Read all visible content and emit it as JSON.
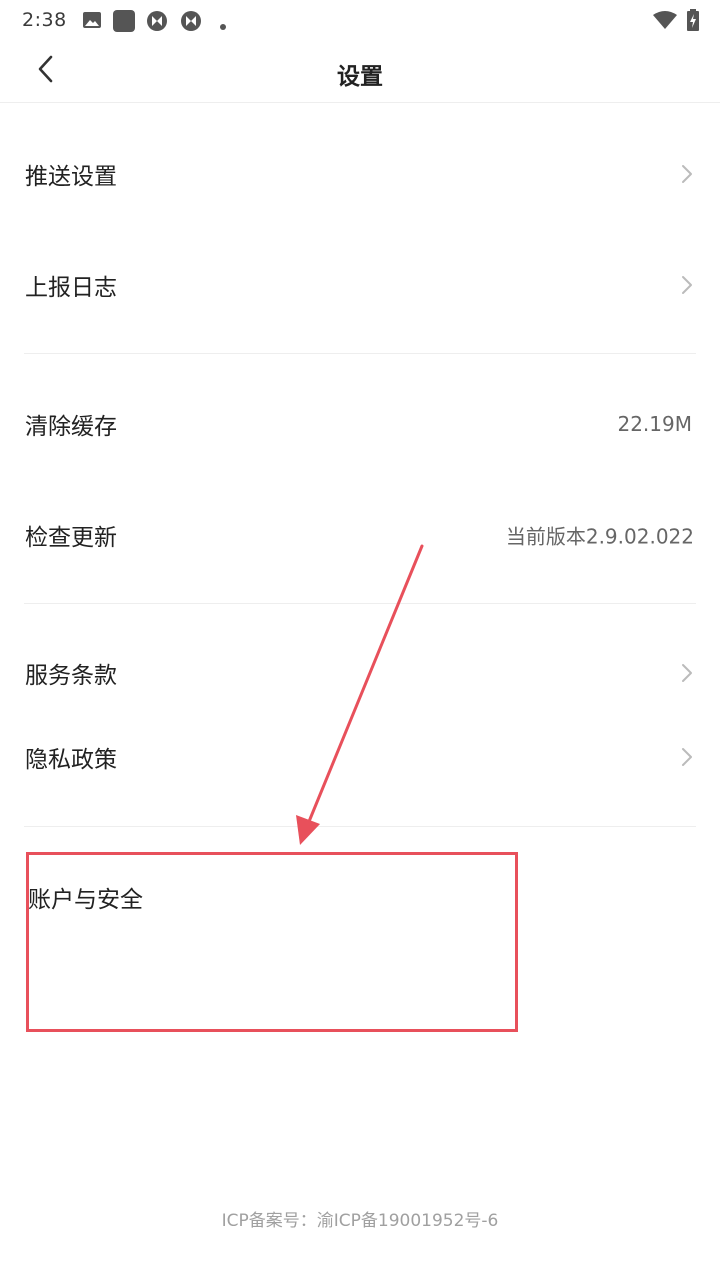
{
  "status_bar": {
    "time": "2:38",
    "icons": [
      "image-icon",
      "square-icon",
      "aperture-icon",
      "aperture-icon",
      "dot-icon"
    ],
    "right_icons": [
      "wifi-icon",
      "battery-charging-icon"
    ]
  },
  "header": {
    "title": "设置"
  },
  "settings": {
    "push": {
      "label": "推送设置"
    },
    "log": {
      "label": "上报日志"
    },
    "cache": {
      "label": "清除缓存",
      "value": "22.19M"
    },
    "update": {
      "label": "检查更新",
      "value": "当前版本2.9.02.022"
    },
    "terms": {
      "label": "服务条款"
    },
    "privacy": {
      "label": "隐私政策"
    },
    "account": {
      "label": "账户与安全"
    }
  },
  "footer": {
    "icp": "ICP备案号：渝ICP备19001952号-6"
  },
  "annotation": {
    "color": "#e8505b"
  }
}
